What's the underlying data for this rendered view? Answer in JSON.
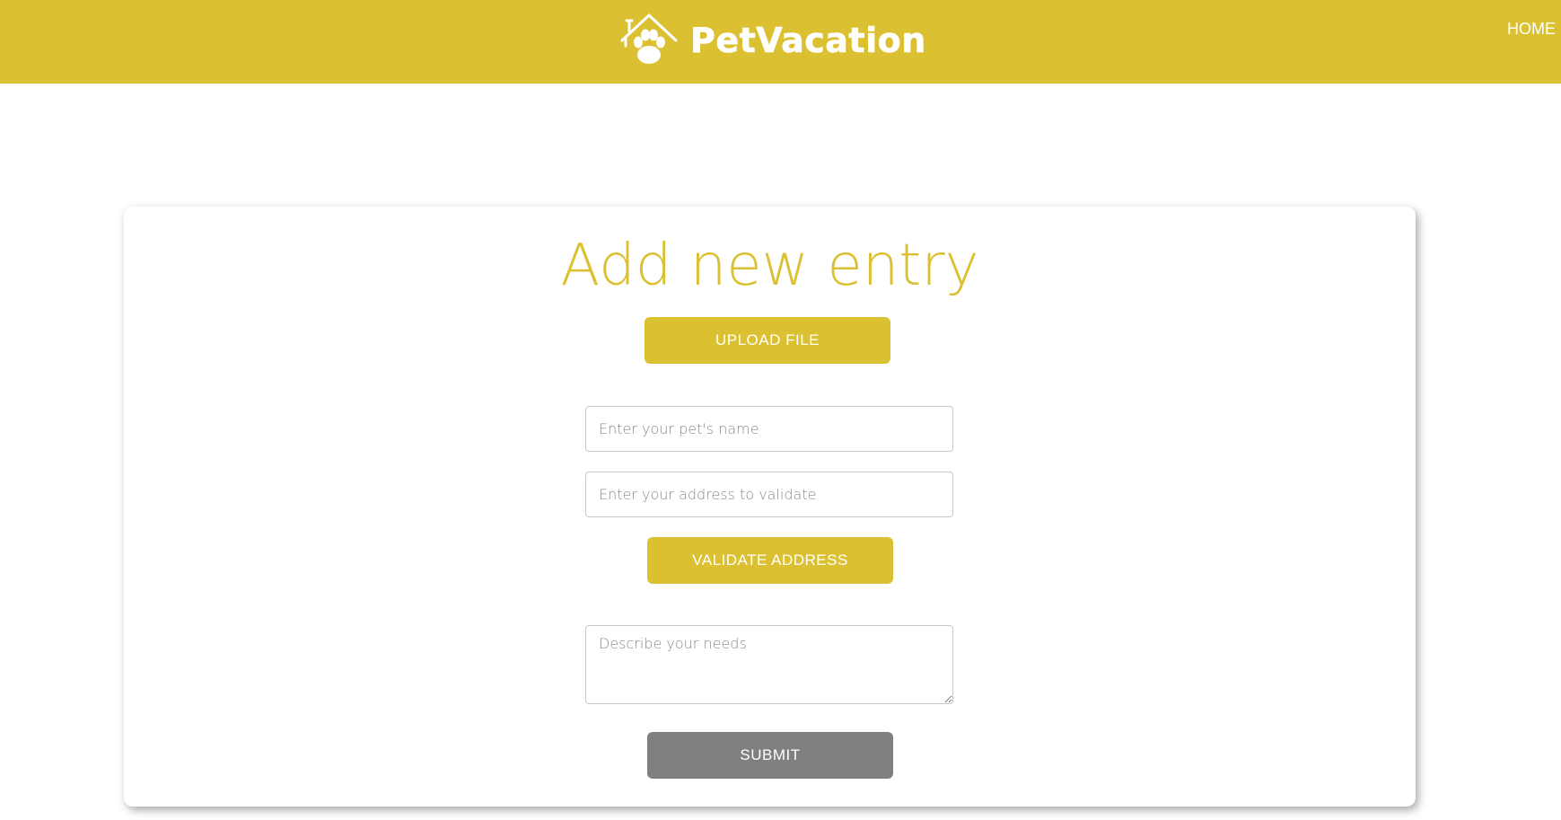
{
  "header": {
    "logo_text": "PetVacation",
    "nav_home": "HOME",
    "background_color": "#dbc032"
  },
  "form": {
    "title": "Add new entry",
    "upload_label": "UPLOAD FILE",
    "pet_name_placeholder": "Enter your pet's name",
    "address_placeholder": "Enter your address to validate",
    "validate_label": "VALIDATE ADDRESS",
    "needs_placeholder": "Describe your needs",
    "submit_label": "SUBMIT",
    "accent_color": "#dbc032",
    "submit_color": "#808080"
  },
  "icons": {
    "logo": "house-paw-icon"
  }
}
